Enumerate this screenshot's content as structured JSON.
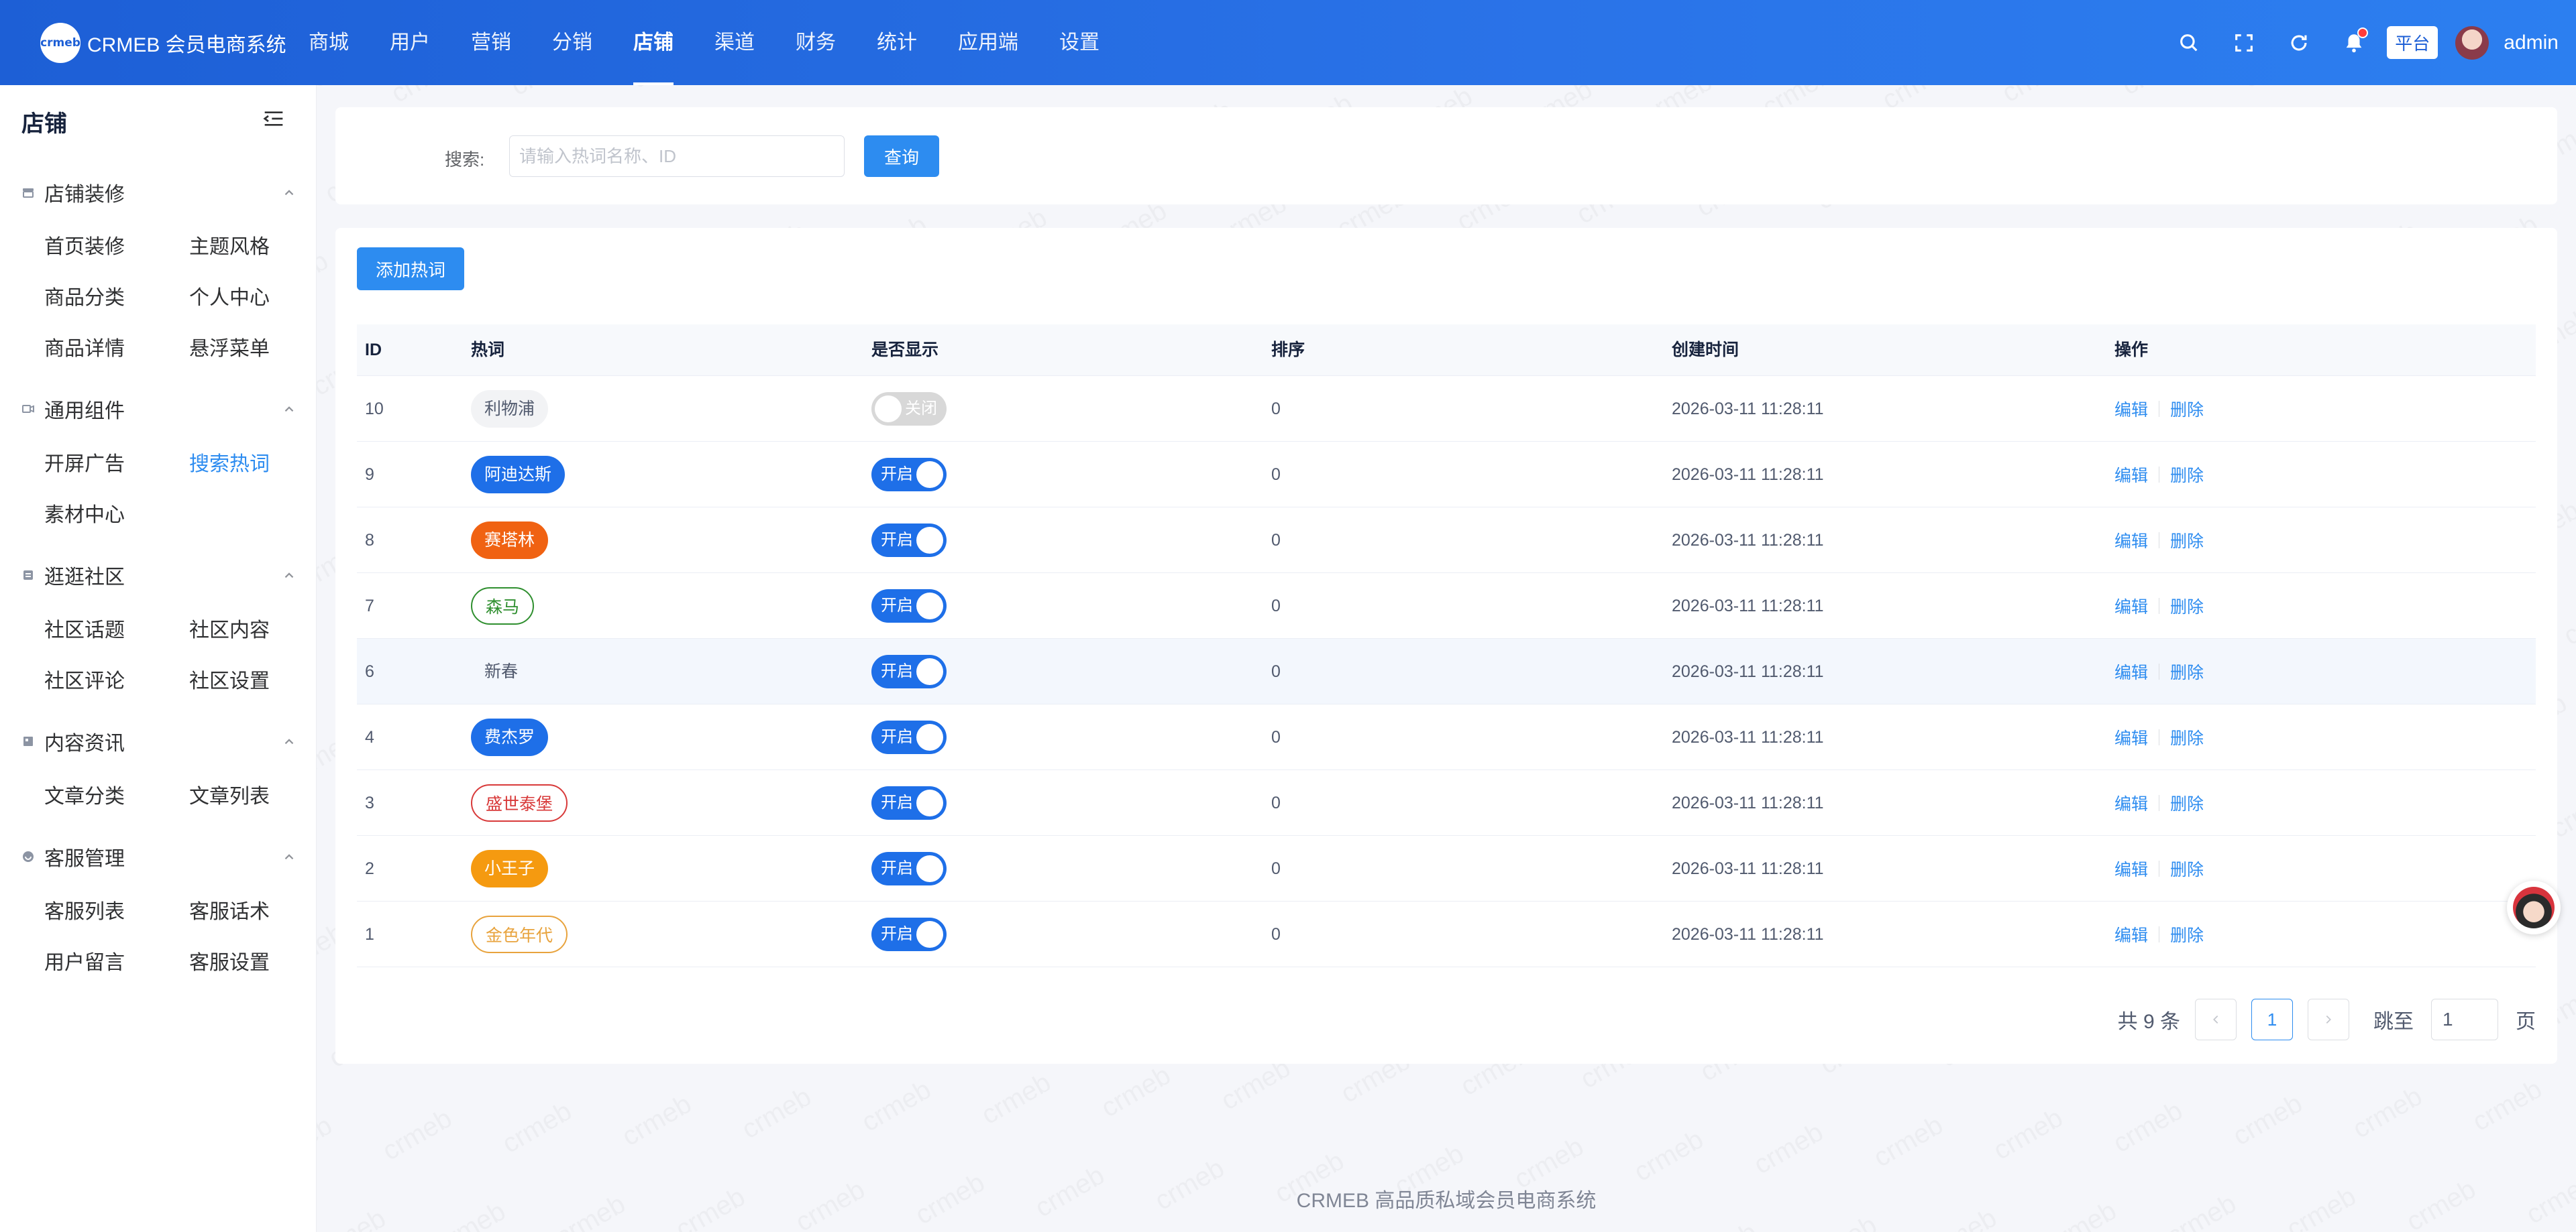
{
  "header": {
    "logo_mark": "crmeb",
    "logo_text": "CRMEB 会员电商系统",
    "nav": [
      "商城",
      "用户",
      "营销",
      "分销",
      "店铺",
      "渠道",
      "财务",
      "统计",
      "应用端",
      "设置"
    ],
    "active_nav": "店铺",
    "platform_badge": "平台",
    "username": "admin"
  },
  "sidebar": {
    "title": "店铺",
    "groups": [
      {
        "label": "店铺装修",
        "icon": "storefront-icon",
        "items": [
          "首页装修",
          "主题风格",
          "商品分类",
          "个人中心",
          "商品详情",
          "悬浮菜单"
        ]
      },
      {
        "label": "通用组件",
        "icon": "component-icon",
        "items": [
          "开屏广告",
          "搜索热词",
          "素材中心"
        ]
      },
      {
        "label": "逛逛社区",
        "icon": "community-icon",
        "items": [
          "社区话题",
          "社区内容",
          "社区评论",
          "社区设置"
        ]
      },
      {
        "label": "内容资讯",
        "icon": "article-icon",
        "items": [
          "文章分类",
          "文章列表"
        ]
      },
      {
        "label": "客服管理",
        "icon": "service-icon",
        "items": [
          "客服列表",
          "客服话术",
          "用户留言",
          "客服设置"
        ]
      }
    ],
    "active_item": "搜索热词"
  },
  "search": {
    "label": "搜索:",
    "placeholder": "请输入热词名称、ID",
    "value": "",
    "button": "查询"
  },
  "toolbar": {
    "add_label": "添加热词"
  },
  "table": {
    "columns": [
      "ID",
      "热词",
      "是否显示",
      "排序",
      "创建时间",
      "操作"
    ],
    "rows": [
      {
        "id": "10",
        "word": "利物浦",
        "tag_style": "plain-grey",
        "show": "关闭",
        "sort": "0",
        "time": "2026-03-11 11:28:11",
        "edit": "编辑",
        "del": "删除"
      },
      {
        "id": "9",
        "word": "阿迪达斯",
        "tag_style": "solid-blue",
        "show": "开启",
        "sort": "0",
        "time": "2026-03-11 11:28:11",
        "edit": "编辑",
        "del": "删除"
      },
      {
        "id": "8",
        "word": "赛塔林",
        "tag_style": "solid-orange",
        "show": "开启",
        "sort": "0",
        "time": "2026-03-11 11:28:11",
        "edit": "编辑",
        "del": "删除"
      },
      {
        "id": "7",
        "word": "森马",
        "tag_style": "outline-green",
        "show": "开启",
        "sort": "0",
        "time": "2026-03-11 11:28:11",
        "edit": "编辑",
        "del": "删除"
      },
      {
        "id": "6",
        "word": "新春",
        "tag_style": "plain",
        "show": "开启",
        "sort": "0",
        "time": "2026-03-11 11:28:11",
        "edit": "编辑",
        "del": "删除"
      },
      {
        "id": "4",
        "word": "费杰罗",
        "tag_style": "solid-blue",
        "show": "开启",
        "sort": "0",
        "time": "2026-03-11 11:28:11",
        "edit": "编辑",
        "del": "删除"
      },
      {
        "id": "3",
        "word": "盛世泰堡",
        "tag_style": "outline-red",
        "show": "开启",
        "sort": "0",
        "time": "2026-03-11 11:28:11",
        "edit": "编辑",
        "del": "删除"
      },
      {
        "id": "2",
        "word": "小王子",
        "tag_style": "solid-amber",
        "show": "开启",
        "sort": "0",
        "time": "2026-03-11 11:28:11",
        "edit": "编辑",
        "del": "删除"
      },
      {
        "id": "1",
        "word": "金色年代",
        "tag_style": "outline-amber",
        "show": "开启",
        "sort": "0",
        "time": "2026-03-11 11:28:11",
        "edit": "编辑",
        "del": "删除"
      }
    ]
  },
  "pagination": {
    "total_text": "共 9 条",
    "current_page": "1",
    "jump_label": "跳至",
    "jump_value": "1",
    "page_suffix": "页"
  },
  "footer": {
    "text": "CRMEB 高品质私域会员电商系统"
  },
  "watermark_text": "crmeb",
  "colors": {
    "primary": "#2d8cf0",
    "header_start": "#1d5fd6",
    "header_end": "#2c7ff0",
    "switch_on": "#1e6fe8",
    "tag_blue": "#1e6fe8",
    "tag_orange": "#f06212",
    "tag_green": "#2f8f2f",
    "tag_red": "#d83a3a",
    "tag_amber": "#f59a10",
    "tag_amber_outline": "#e8a33d"
  }
}
